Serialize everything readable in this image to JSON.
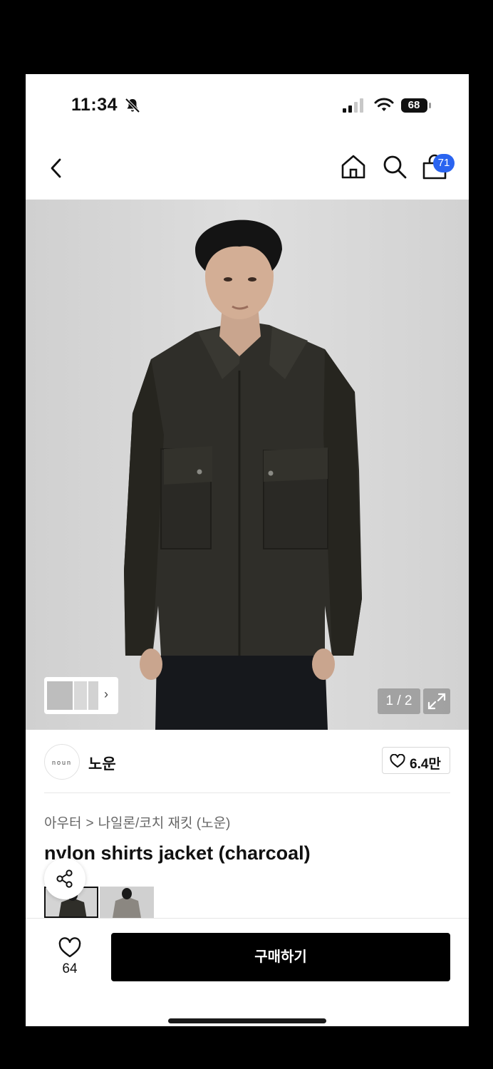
{
  "status": {
    "time": "11:34",
    "battery": "68"
  },
  "nav": {
    "cart_count": "71"
  },
  "gallery": {
    "counter": "1 / 2"
  },
  "brand": {
    "logo_text": "noun",
    "name": "노운",
    "likes": "6.4만"
  },
  "breadcrumb": {
    "level1": "아우터",
    "separator": ">",
    "level2": "나일론/코치 재킷 (노운)"
  },
  "product": {
    "title": "nylon shirts jacket (charcoal)"
  },
  "bottom_bar": {
    "wish_count": "64",
    "buy_label": "구매하기"
  },
  "colors": {
    "accent": "#2a64f0",
    "jacket": "#2f2e29",
    "background": "#d8d8d8"
  },
  "icons": [
    "back-icon",
    "home-icon",
    "search-icon",
    "shopping-bag-icon",
    "bell-slash-icon",
    "signal-icon",
    "wifi-icon",
    "battery-icon",
    "chevron-right-icon",
    "expand-icon",
    "heart-icon",
    "share-icon"
  ]
}
